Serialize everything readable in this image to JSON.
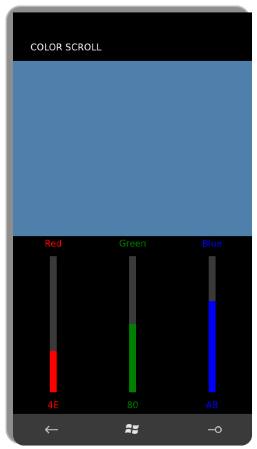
{
  "app": {
    "title": "COLOR SCROLL"
  },
  "preview": {
    "color": "#4E80AB"
  },
  "channels": [
    {
      "label": "Red",
      "value_hex": "4E",
      "value": 78,
      "color": "#FF0000"
    },
    {
      "label": "Green",
      "value_hex": "80",
      "value": 128,
      "color": "#008000"
    },
    {
      "label": "Blue",
      "value_hex": "AB",
      "value": 171,
      "color": "#0000FF"
    }
  ],
  "nav": {
    "back_icon": "back-arrow-icon",
    "start_icon": "windows-logo-icon",
    "search_icon": "search-icon"
  }
}
